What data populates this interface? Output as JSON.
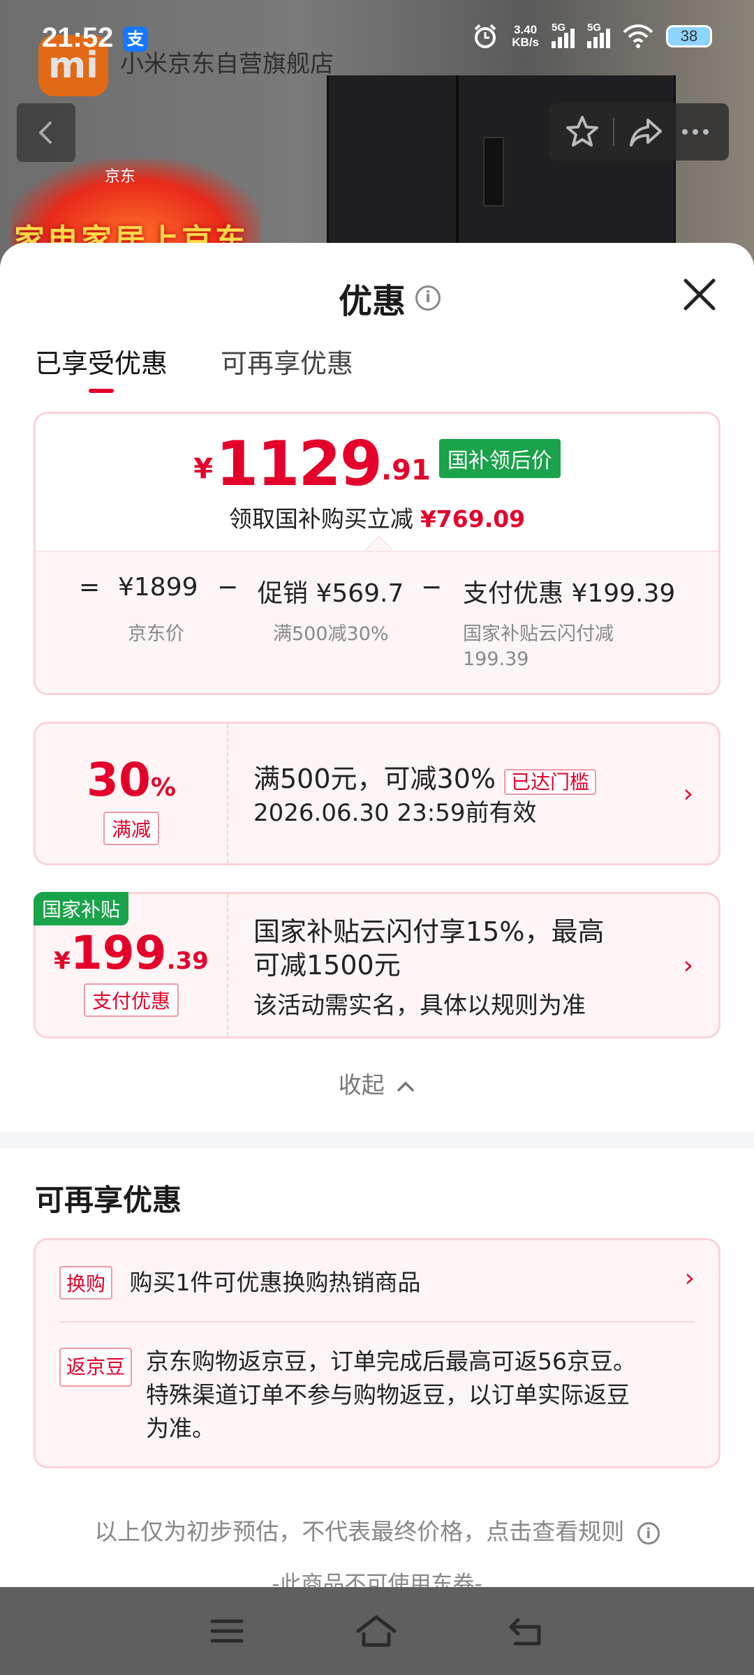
{
  "status_bar": {
    "time": "21:52",
    "alipay_glyph": "支",
    "net_speed_value": "3.40",
    "net_speed_unit": "KB/s",
    "sim1": "5G",
    "sim2": "5G",
    "battery": "38"
  },
  "background": {
    "store_name": "小米京东自营旗舰店",
    "logo_text": "mi",
    "banner_tag": "京东",
    "banner_text": "家电家居上京东"
  },
  "sheet": {
    "title": "优惠",
    "tabs": [
      {
        "label": "已享受优惠",
        "active": true
      },
      {
        "label": "可再享优惠",
        "active": false
      }
    ]
  },
  "summary": {
    "currency": "¥",
    "price_int": "1129",
    "price_dec": ".91",
    "price_tag": "国补领后价",
    "subtitle": "领取国补购买立减",
    "subtitle_amount": "¥769.09",
    "eq": "=",
    "minus": "−",
    "jd_price": "¥1899",
    "jd_price_label": "京东价",
    "promo": "促销 ¥569.7",
    "promo_label": "满500减30%",
    "pay": "支付优惠 ¥199.39",
    "pay_label_line1": "国家补贴云闪付减",
    "pay_label_line2": "199.39"
  },
  "coupons": [
    {
      "value": "30",
      "unit": "%",
      "type_tag": "满减",
      "title": "满500元，可减30%",
      "status_tag": "已达门槛",
      "desc": "2026.06.30 23:59前有效"
    },
    {
      "badge": "国家补贴",
      "currency": "¥",
      "value": "199",
      "decimal": ".39",
      "type_tag": "支付优惠",
      "title_line1": "国家补贴云闪付享15%，最高",
      "title_line2": "可减1500元",
      "desc": "该活动需实名，具体以规则为准"
    }
  ],
  "collapse_label": "收起",
  "more_section": {
    "title": "可再享优惠",
    "items": [
      {
        "tag": "换购",
        "text": "购买1件可优惠换购热销商品"
      },
      {
        "tag": "返京豆",
        "text_line1": "京东购物返京豆，订单完成后最高可返56京豆。",
        "text_line2": "特殊渠道订单不参与购物返豆，以订单实际返豆",
        "text_line3": "为准。"
      }
    ]
  },
  "footnote": "以上仅为初步预估，不代表最终价格，点击查看规则",
  "footnote2": "-此商品不可使用东券-",
  "colors": {
    "accent_red": "#e4002b",
    "gov_green": "#1aa34a"
  }
}
